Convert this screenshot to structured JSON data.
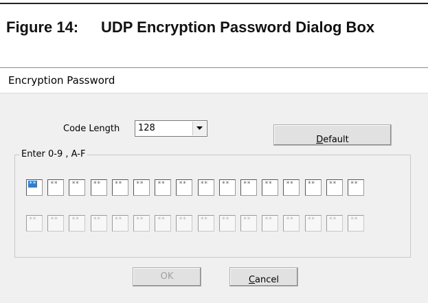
{
  "figure": {
    "label": "Figure 14:",
    "title": "UDP Encryption Password Dialog Box"
  },
  "dialog": {
    "title": "Encryption Password",
    "code_length_label": "Code Length",
    "code_length_value": "128",
    "default_button": {
      "accel": "D",
      "rest": "efault"
    },
    "group_label": "Enter 0-9 , A-F",
    "row1_values": [
      "**",
      "**",
      "**",
      "**",
      "**",
      "**",
      "**",
      "**",
      "**",
      "**",
      "**",
      "**",
      "**",
      "**",
      "**",
      "**"
    ],
    "row2_values": [
      "**",
      "**",
      "**",
      "**",
      "**",
      "**",
      "**",
      "**",
      "**",
      "**",
      "**",
      "**",
      "**",
      "**",
      "**",
      "**"
    ],
    "ok_label": "OK",
    "cancel_button": {
      "accel": "C",
      "rest": "ancel"
    }
  }
}
